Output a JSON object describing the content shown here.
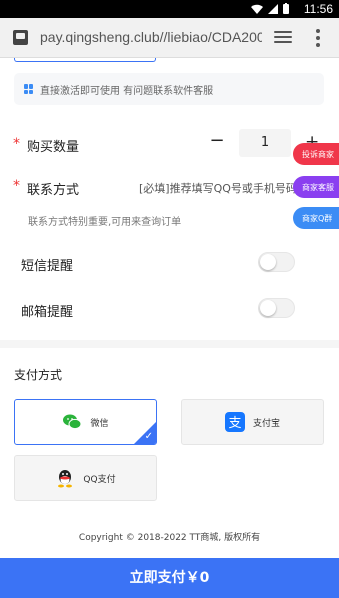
{
  "status_bar": {
    "time": "11:56"
  },
  "browser": {
    "url": "pay.qingsheng.club//liebiao/CDA200"
  },
  "notice": {
    "text": "直接激活即可使用 有问题联系软件客服"
  },
  "quantity": {
    "label": "购买数量",
    "value": "1",
    "minus": "−",
    "plus": "+"
  },
  "contact": {
    "label": "联系方式",
    "placeholder": "[必填]推荐填写QQ号或手机号码",
    "hint": "联系方式特别重要,可用来查询订单"
  },
  "sms_reminder": {
    "label": "短信提醒",
    "enabled": false
  },
  "email_reminder": {
    "label": "邮箱提醒",
    "enabled": false
  },
  "payment": {
    "title": "支付方式",
    "options": [
      {
        "label": "微信",
        "icon": "wechat-icon",
        "selected": true
      },
      {
        "label": "支付宝",
        "icon": "alipay-icon",
        "selected": false
      },
      {
        "label": "QQ支付",
        "icon": "qq-icon",
        "selected": false
      }
    ]
  },
  "floating": [
    {
      "label": "投诉商家",
      "color": "#f0364a"
    },
    {
      "label": "商家客服",
      "color": "#8a3ff0"
    },
    {
      "label": "商家Q群",
      "color": "#3b8cf5"
    }
  ],
  "footer": {
    "copyright": "Copyright © 2018-2022 TT商城, 版权所有"
  },
  "pay_button": {
    "label": "立即支付￥0"
  },
  "colors": {
    "accent": "#3b73f5",
    "required": "#e33333",
    "wechat": "#2bb33b",
    "alipay": "#1677ff"
  }
}
